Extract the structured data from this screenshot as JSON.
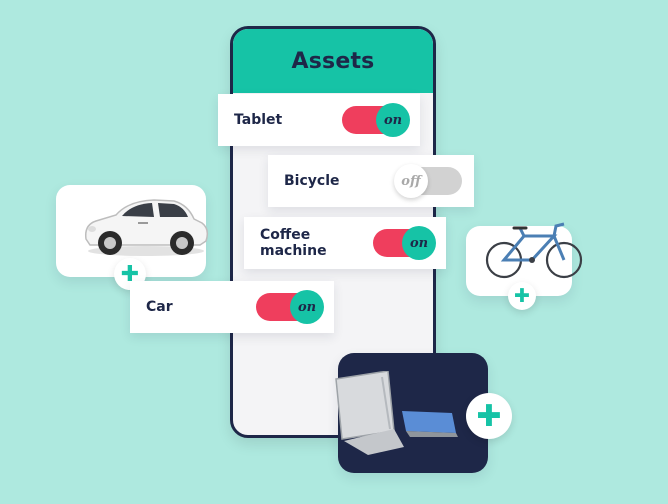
{
  "phone": {
    "title": "Assets"
  },
  "assets": [
    {
      "id": "tablet",
      "label": "Tablet",
      "state": "on"
    },
    {
      "id": "bicycle",
      "label": "Bicycle",
      "state": "off"
    },
    {
      "id": "coffee",
      "label": "Coffee machine",
      "state": "on"
    },
    {
      "id": "car",
      "label": "Car",
      "state": "on"
    }
  ],
  "add_buttons": {
    "glyph": "✚"
  },
  "icons": [
    "car-image",
    "bicycle-image",
    "tablet-image",
    "plus-icon"
  ],
  "colors": {
    "background": "#aee9df",
    "accent": "#16c3a6",
    "toggle_on": "#ef3e5d",
    "toggle_off": "#d2d2d2",
    "navy": "#1e2748"
  }
}
